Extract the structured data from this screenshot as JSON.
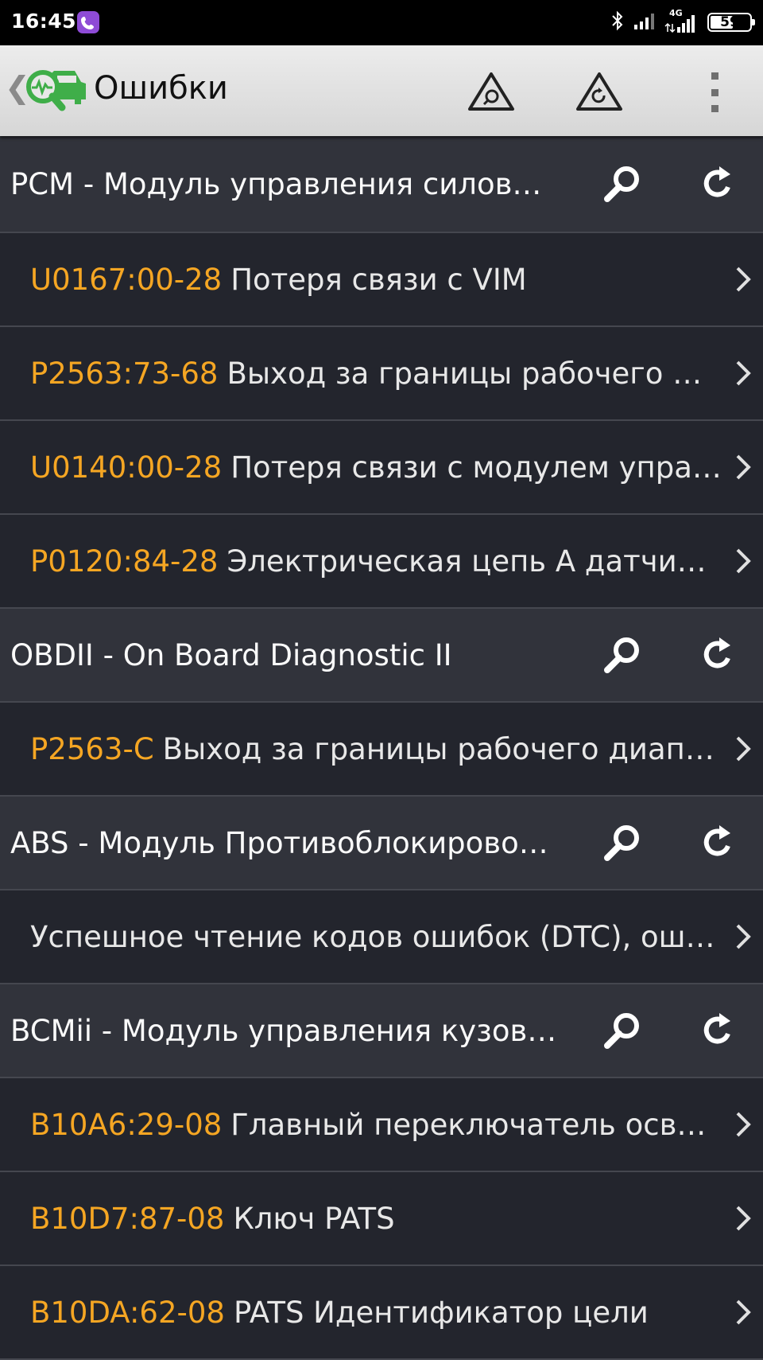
{
  "status_bar": {
    "time": "16:45",
    "network": "4G",
    "battery": "59",
    "battery_level": 0.59
  },
  "app_bar": {
    "title": "Ошибки",
    "icons": [
      "back-icon",
      "car-diagnostic-logo",
      "warning-search-icon",
      "warning-refresh-icon",
      "more-vert-icon"
    ]
  },
  "colors": {
    "background": "#23252d",
    "module_header_bg": "#31333b",
    "dtc_code": "#f5a623",
    "app_bar": "#e3e3e3",
    "logo_green": "#3fae49"
  },
  "modules": [
    {
      "name": "PCM - Модуль управления силовым агрегатом",
      "items": [
        {
          "code": "U0167:00-28",
          "text": "Потеря связи с VIM"
        },
        {
          "code": "P2563:73-68",
          "text": "Выход за границы рабочего диапазона"
        },
        {
          "code": "U0140:00-28",
          "text": "Потеря связи с модулем управления кузовом"
        },
        {
          "code": "P0120:84-28",
          "text": "Электрическая цепь А датчика положения"
        }
      ]
    },
    {
      "name": "OBDII - On Board Diagnostic II",
      "items": [
        {
          "code": "P2563-C",
          "text": "Выход за границы рабочего диапазона"
        }
      ]
    },
    {
      "name": "ABS - Модуль Противоблокировочной системы",
      "items": [
        {
          "code": "",
          "text": "Успешное чтение кодов ошибок (DTC), ошибок не найдено"
        }
      ]
    },
    {
      "name": "BCMii - Модуль управления кузовом",
      "items": [
        {
          "code": "B10A6:29-08",
          "text": "Главный переключатель освещения"
        },
        {
          "code": "B10D7:87-08",
          "text": "Ключ PATS"
        },
        {
          "code": "B10DA:62-08",
          "text": "PATS Идентификатор цели"
        }
      ]
    }
  ]
}
